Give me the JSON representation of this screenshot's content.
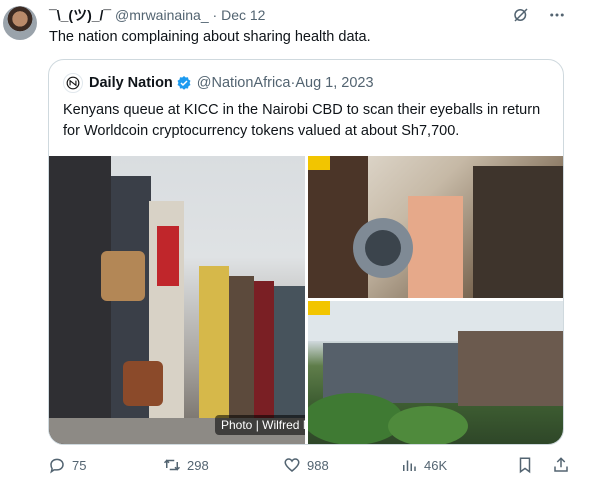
{
  "tweet": {
    "display_name": "¯\\_(ツ)_/¯",
    "handle": "@mrwainaina_",
    "separator": "·",
    "date": "Dec 12",
    "text": "The nation complaining about sharing health data."
  },
  "quote": {
    "display_name": "Daily Nation",
    "handle": "@NationAfrica",
    "separator": "·",
    "date": "Aug 1, 2023",
    "text": "Kenyans queue at KICC in the Nairobi CBD to scan their eyeballs in return for Worldcoin cryptocurrency tokens valued at about Sh7,700.",
    "photo_credit": "Photo | Wilfred N"
  },
  "actions": {
    "replies": "75",
    "reposts": "298",
    "likes": "988",
    "views": "46K"
  },
  "colors": {
    "text": "#0f1419",
    "muted": "#536471",
    "border": "#cfd9de",
    "verified": "#1d9bf0"
  }
}
